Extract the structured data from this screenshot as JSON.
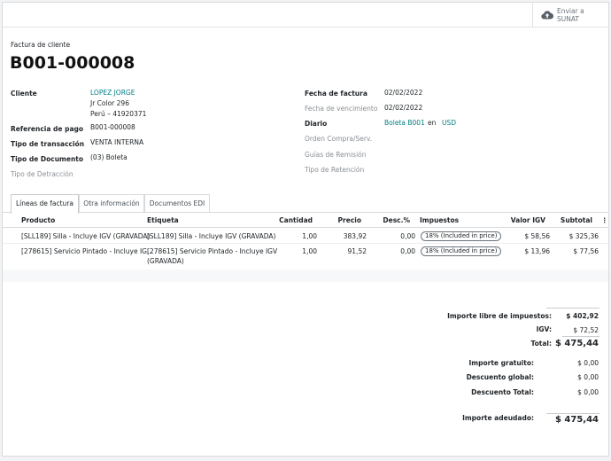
{
  "toolbar": {
    "send_sunat_line1": "Enviar a",
    "send_sunat_line2": "SUNAT",
    "icon": "cloud-upload-icon"
  },
  "header": {
    "doc_type": "Factura de cliente",
    "doc_number": "B001-000008"
  },
  "left_fields": {
    "cliente_label": "Cliente",
    "cliente_name": "LOPEZ JORGE",
    "cliente_addr1": "Jr Color 296",
    "cliente_addr2": "Perú – 41920371",
    "ref_label": "Referencia de pago",
    "ref_value": "B001-000008",
    "tipo_trans_label": "Tipo de transacción",
    "tipo_trans_value": "VENTA INTERNA",
    "tipo_doc_label": "Tipo de Documento",
    "tipo_doc_value": "(03) Boleta",
    "tipo_detr_label": "Tipo de Detracción"
  },
  "right_fields": {
    "fecha_factura_label": "Fecha de factura",
    "fecha_factura_value": "02/02/2022",
    "fecha_venc_label": "Fecha de vencimiento",
    "fecha_venc_value": "02/02/2022",
    "diario_label": "Diario",
    "diario_value": "Boleta B001",
    "diario_en": "en",
    "diario_currency": "USD",
    "orden_label": "Orden Compra/Serv.",
    "guias_label": "Guías de Remisión",
    "tipo_ret_label": "Tipo de Retención"
  },
  "tabs": [
    {
      "label": "Líneas de factura",
      "active": true
    },
    {
      "label": "Otra información",
      "active": false
    },
    {
      "label": "Documentos EDI",
      "active": false
    }
  ],
  "table": {
    "headers": {
      "producto": "Producto",
      "etiqueta": "Etiqueta",
      "cantidad": "Cantidad",
      "precio": "Precio",
      "desc": "Desc.%",
      "impuestos": "Impuestos",
      "valor_igv": "Valor IGV",
      "subtotal": "Subtotal",
      "options": "⋮"
    },
    "rows": [
      {
        "producto": "[SLL189] Silla - Incluye IGV (GRAVADA)",
        "etiqueta1": "[SLL189] Silla - Incluye IGV (GRAVADA)",
        "etiqueta2": "",
        "cantidad": "1,00",
        "precio": "383,92",
        "desc": "0,00",
        "impuestos": "18% (Included in price)",
        "valor_igv": "$ 58,56",
        "subtotal": "$ 325,36"
      },
      {
        "producto": "[278615] Servicio Pintado - Incluye IG...",
        "etiqueta1": "[278615] Servicio Pintado - Incluye IGV",
        "etiqueta2": "(GRAVADA)",
        "cantidad": "1,00",
        "precio": "91,52",
        "desc": "0,00",
        "impuestos": "18% (Included in price)",
        "valor_igv": "$ 13,96",
        "subtotal": "$ 77,56"
      }
    ]
  },
  "totals": {
    "libre_label": "Importe libre de impuestos:",
    "libre_value": "$ 402,92",
    "igv_label": "IGV:",
    "igv_value": "$ 72,52",
    "total_label": "Total:",
    "total_value": "$ 475,44",
    "gratuito_label": "Importe gratuito:",
    "gratuito_value": "$ 0,00",
    "desc_global_label": "Descuento global:",
    "desc_global_value": "$ 0,00",
    "desc_total_label": "Descuento Total:",
    "desc_total_value": "$ 0,00",
    "adeudado_label": "Importe adeudado:",
    "adeudado_value": "$ 475,44"
  }
}
